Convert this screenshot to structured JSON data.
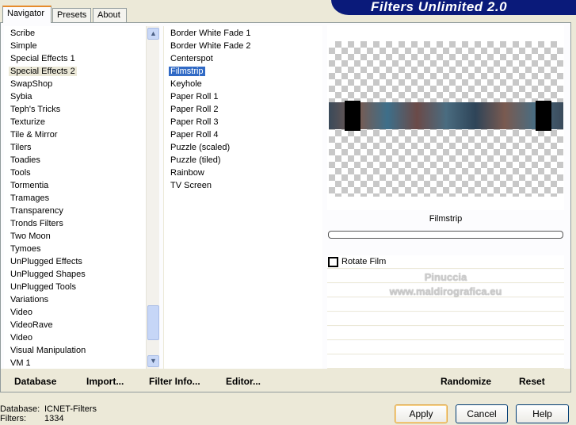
{
  "window": {
    "title": "Filters Unlimited 2.0"
  },
  "tabs": [
    {
      "label": "Navigator",
      "active": true
    },
    {
      "label": "Presets"
    },
    {
      "label": "About"
    }
  ],
  "categories": [
    "Scribe",
    "Simple",
    "Special Effects 1",
    "Special Effects 2",
    "SwapShop",
    "Sybia",
    "Teph's Tricks",
    "Texturize",
    "Tile & Mirror",
    "Tilers",
    "Toadies",
    "Tools",
    "Tormentia",
    "Tramages",
    "Transparency",
    "Tronds Filters",
    "Two Moon",
    "Tymoes",
    "UnPlugged Effects",
    "UnPlugged Shapes",
    "UnPlugged Tools",
    "Variations",
    "Video",
    "VideoRave",
    "Video",
    "Visual Manipulation",
    "VM 1"
  ],
  "selected_category": "Special Effects 2",
  "filters": [
    "Border White Fade 1",
    "Border White Fade 2",
    "Centerspot",
    "Filmstrip",
    "Keyhole",
    "Paper Roll 1",
    "Paper Roll 2",
    "Paper Roll 3",
    "Paper Roll 4",
    "Puzzle (scaled)",
    "Puzzle (tiled)",
    "Rainbow",
    "TV Screen"
  ],
  "selected_filter": "Filmstrip",
  "preview": {
    "filter_name": "Filmstrip",
    "progress": 0
  },
  "params": {
    "rotate_film_label": "Rotate Film",
    "rotate_film_checked": false
  },
  "watermark": {
    "line1": "Pinuccia",
    "line2": "www.maldirografica.eu"
  },
  "toolbar": {
    "database": "Database",
    "import": "Import...",
    "filter_info": "Filter Info...",
    "editor": "Editor...",
    "randomize": "Randomize",
    "reset": "Reset"
  },
  "status": {
    "database_label": "Database:",
    "database_value": "ICNET-Filters",
    "filters_label": "Filters:",
    "filters_value": "1334"
  },
  "buttons": {
    "apply": "Apply",
    "cancel": "Cancel",
    "help": "Help"
  },
  "colors": {
    "selection": "#316ac5",
    "banner": "#0a1a7a",
    "background": "#ece9d8"
  }
}
